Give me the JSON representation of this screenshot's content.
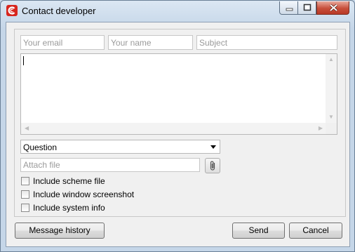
{
  "window": {
    "title": "Contact developer"
  },
  "form": {
    "email_placeholder": "Your email",
    "name_placeholder": "Your name",
    "subject_placeholder": "Subject",
    "message_value": "",
    "category": {
      "selected": "Question"
    },
    "attach_placeholder": "Attach file",
    "checkboxes": [
      {
        "label": "Include scheme file",
        "checked": false
      },
      {
        "label": "Include window screenshot",
        "checked": false
      },
      {
        "label": "Include system info",
        "checked": false
      }
    ]
  },
  "buttons": {
    "history": "Message history",
    "send": "Send",
    "cancel": "Cancel"
  },
  "icons": {
    "app": "app-logo-icon",
    "minimize": "minimize-icon",
    "maximize": "maximize-icon",
    "close": "close-icon",
    "attach": "paperclip-icon",
    "dropdown": "chevron-down-icon"
  },
  "colors": {
    "brand_red": "#d7261e",
    "close_button": "#c74e3a",
    "window_frame": "#c5d6e8"
  }
}
